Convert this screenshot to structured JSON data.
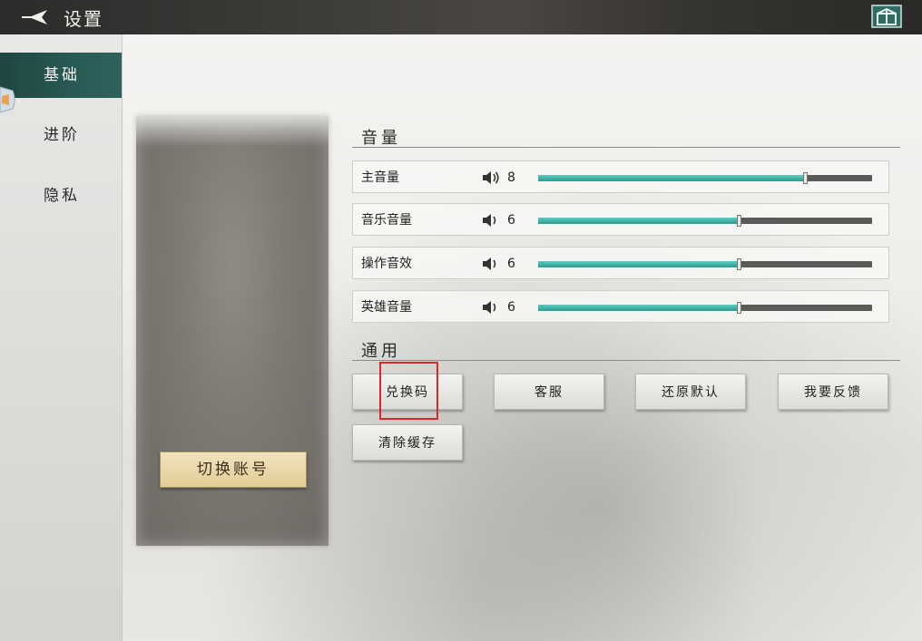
{
  "header": {
    "title": "设置",
    "back_icon": "back-arrow-icon",
    "right_icon": "gift-box-icon"
  },
  "sidebar": {
    "items": [
      {
        "label": "基础",
        "active": true
      },
      {
        "label": "进阶",
        "active": false
      },
      {
        "label": "隐私",
        "active": false
      }
    ]
  },
  "account": {
    "switch_label": "切换账号"
  },
  "volume": {
    "section_title": "音量",
    "rows": [
      {
        "label": "主音量",
        "value": "8",
        "level": 0.8
      },
      {
        "label": "音乐音量",
        "value": "6",
        "level": 0.6
      },
      {
        "label": "操作音效",
        "value": "6",
        "level": 0.6
      },
      {
        "label": "英雄音量",
        "value": "6",
        "level": 0.6
      }
    ],
    "accent_color": "#3fb3a8"
  },
  "general": {
    "section_title": "通用",
    "buttons": [
      "兑换码",
      "客服",
      "还原默认",
      "我要反馈",
      "清除缓存"
    ]
  },
  "colors": {
    "sidebar_active": "#2a5d57",
    "highlight": "#d42a2a",
    "switch_button": "#e9d6a7"
  }
}
